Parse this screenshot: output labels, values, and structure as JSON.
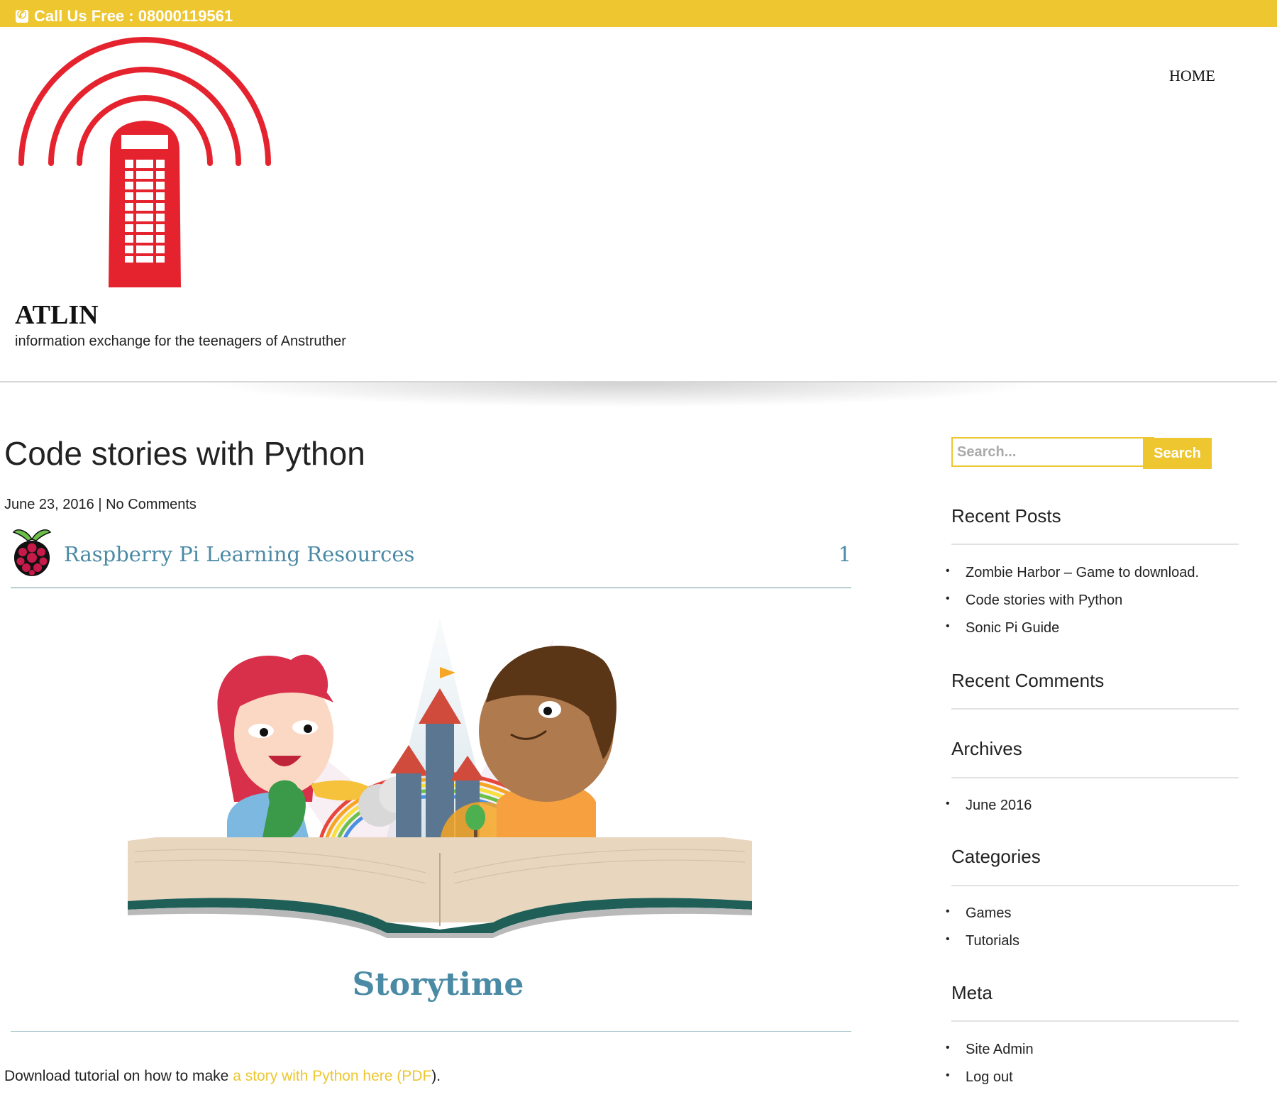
{
  "topbar": {
    "call_text": "Call Us Free : 08000119561"
  },
  "header": {
    "site_title": "ATLIN",
    "site_description": "information exchange for the teenagers of Anstruther",
    "nav": [
      {
        "label": "HOME"
      }
    ]
  },
  "post": {
    "title": "Code stories with Python",
    "meta_date": "June 23, 2016",
    "meta_sep": " | ",
    "meta_comments": "No Comments",
    "resource_header": {
      "title": "Raspberry Pi Learning Resources",
      "count": "1"
    },
    "feature_title": "Storytime",
    "download_prefix": "Download tutorial on how to make ",
    "download_link": "a story with Python here (PDF",
    "download_suffix": ")."
  },
  "sidebar": {
    "search": {
      "placeholder": "Search...",
      "button_label": "Search"
    },
    "recent_posts": {
      "title": "Recent Posts",
      "items": [
        "Zombie Harbor – Game to download.",
        "Code stories with Python",
        "Sonic Pi Guide"
      ]
    },
    "recent_comments": {
      "title": "Recent Comments"
    },
    "archives": {
      "title": "Archives",
      "items": [
        "June 2016"
      ]
    },
    "categories": {
      "title": "Categories",
      "items": [
        "Games",
        "Tutorials"
      ]
    },
    "meta": {
      "title": "Meta",
      "items": [
        "Site Admin",
        "Log out"
      ]
    }
  },
  "colors": {
    "accent": "#edc630",
    "link_blue": "#4a8aa4",
    "logo_red": "#e5232e"
  },
  "icons": [
    "phone-icon",
    "phone-box-logo",
    "raspberry-pi-logo",
    "storytime-illustration"
  ]
}
